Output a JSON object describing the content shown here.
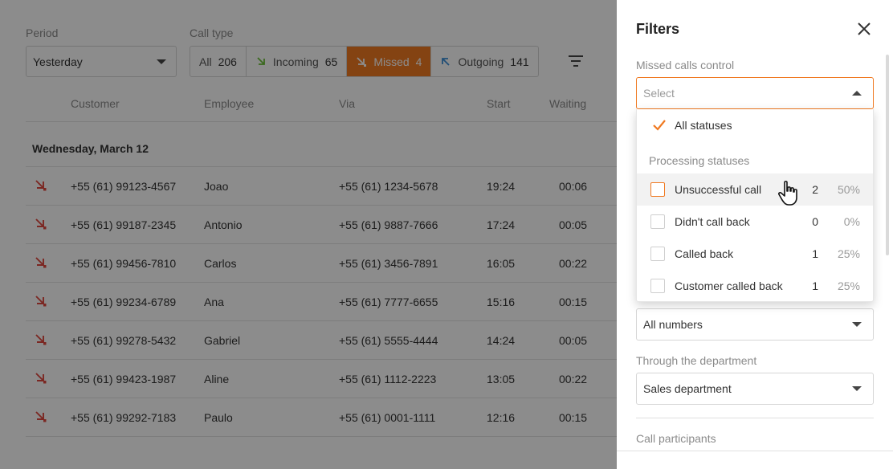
{
  "filters_bar": {
    "period_label": "Period",
    "period_value": "Yesterday",
    "calltype_label": "Call type",
    "call_types": [
      {
        "label": "All",
        "count": "206",
        "icon": "",
        "active": false
      },
      {
        "label": "Incoming",
        "count": "65",
        "icon": "incoming-arrow-icon",
        "active": false
      },
      {
        "label": "Missed",
        "count": "4",
        "icon": "missed-arrow-icon",
        "active": true
      },
      {
        "label": "Outgoing",
        "count": "141",
        "icon": "outgoing-arrow-icon",
        "active": false
      }
    ]
  },
  "table": {
    "headers": {
      "customer": "Customer",
      "employee": "Employee",
      "via": "Via",
      "start": "Start",
      "waiting": "Waiting"
    },
    "day": "Wednesday, March 12",
    "rows": [
      {
        "customer": "+55 (61) 99123-4567",
        "employee": "Joao",
        "via": "+55 (61) 1234-5678",
        "start": "19:24",
        "waiting": "00:06"
      },
      {
        "customer": "+55 (61) 99187-2345",
        "employee": "Antonio",
        "via": "+55 (61) 9887-7666",
        "start": "17:24",
        "waiting": "00:05"
      },
      {
        "customer": "+55 (61) 99456-7810",
        "employee": "Carlos",
        "via": "+55 (61) 3456-7891",
        "start": "16:05",
        "waiting": "00:22"
      },
      {
        "customer": "+55 (61) 99234-6789",
        "employee": "Ana",
        "via": "+55 (61) 7777-6655",
        "start": "15:16",
        "waiting": "00:15"
      },
      {
        "customer": "+55 (61) 99278-5432",
        "employee": "Gabriel",
        "via": "+55 (61) 5555-4444",
        "start": "14:24",
        "waiting": "00:05"
      },
      {
        "customer": "+55 (61) 99423-1987",
        "employee": "Aline",
        "via": "+55 (61) 1112-2223",
        "start": "13:05",
        "waiting": "00:22"
      },
      {
        "customer": "+55 (61) 99292-7183",
        "employee": "Paulo",
        "via": "+55 (61) 0001-1111",
        "start": "12:16",
        "waiting": "00:15"
      }
    ]
  },
  "drawer": {
    "title": "Filters",
    "missed_label": "Missed calls control",
    "missed_placeholder": "Select",
    "dropdown": {
      "all_label": "All statuses",
      "group_label": "Processing statuses",
      "items": [
        {
          "label": "Unsuccessful call",
          "count": "2",
          "percent": "50%"
        },
        {
          "label": "Didn't call back",
          "count": "0",
          "percent": "0%"
        },
        {
          "label": "Called back",
          "count": "1",
          "percent": "25%"
        },
        {
          "label": "Customer called back",
          "count": "1",
          "percent": "25%"
        }
      ]
    },
    "numbers_value": "All numbers",
    "department_label": "Through the department",
    "department_value": "Sales department",
    "participants_label": "Call participants"
  },
  "colors": {
    "accent": "#f07a22",
    "missed": "#e0483e",
    "incoming": "#6cbf3a",
    "outgoing": "#3b8ed8"
  }
}
